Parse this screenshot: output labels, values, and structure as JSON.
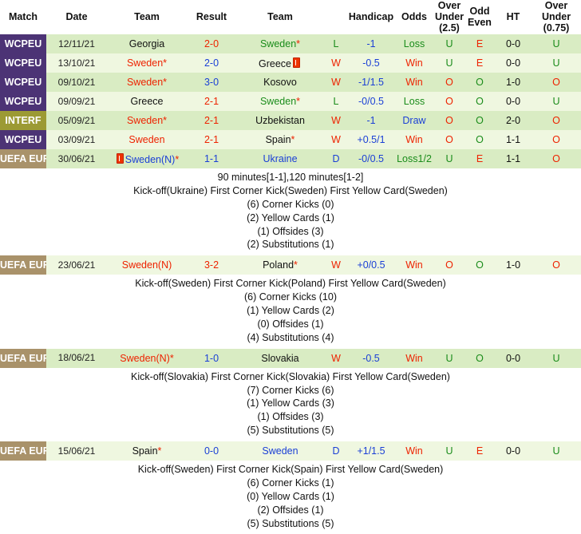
{
  "header": {
    "columns": [
      "Match",
      "Date",
      "Team",
      "Result",
      "Team",
      "Handicap",
      "Odds",
      "Over Under (2.5)",
      "Odd Even",
      "HT",
      "Over Under (0.75)"
    ],
    "col_match": "Match",
    "col_date": "Date",
    "col_team_home": "Team",
    "col_result": "Result",
    "col_team_away": "Team",
    "col_handicap": "Handicap",
    "col_odds": "Odds",
    "col_ou25_l1": "Over",
    "col_ou25_l2": "Under",
    "col_ou25_l3": "(2.5)",
    "col_oddeven_l1": "Odd",
    "col_oddeven_l2": "Even",
    "col_ht": "HT",
    "col_ou075_l1": "Over",
    "col_ou075_l2": "Under",
    "col_ou075_l3": "(0.75)"
  },
  "colors": {
    "league_wcpeu": "#4c3375",
    "league_interf": "#9c9a34",
    "league_euro": "#a9926a",
    "row_dark": "#d9ecc3",
    "row_light": "#eff7e0",
    "win_red": "#ee2200",
    "loss_green": "#1a8c1a",
    "draw_blue": "#1a3fd6",
    "red_card": "#ee3300"
  },
  "rows": [
    {
      "league": "WCPEU",
      "league_type": "wcpeu",
      "date": "12/11/21",
      "home": "Georgia",
      "home_color": "black",
      "home_star": false,
      "home_card": false,
      "result": "2-0",
      "result_color": "red",
      "away": "Sweden",
      "away_color": "green",
      "away_star": true,
      "away_card": false,
      "handicap_res": "L",
      "handicap_res_color": "green",
      "handicap": "-1",
      "handicap_color": "blue",
      "odds": "Loss",
      "odds_color": "green",
      "ou25": "U",
      "ou25_color": "green",
      "oddeven": "E",
      "oddeven_color": "red",
      "ht": "0-0",
      "ou075": "U",
      "ou075_color": "green",
      "detail": null
    },
    {
      "league": "WCPEU",
      "league_type": "wcpeu",
      "date": "13/10/21",
      "home": "Sweden",
      "home_color": "red",
      "home_star": true,
      "home_card": false,
      "result": "2-0",
      "result_color": "blue",
      "away": "Greece",
      "away_color": "black",
      "away_star": false,
      "away_card": true,
      "handicap_res": "W",
      "handicap_res_color": "red",
      "handicap": "-0.5",
      "handicap_color": "blue",
      "odds": "Win",
      "odds_color": "red",
      "ou25": "U",
      "ou25_color": "green",
      "oddeven": "E",
      "oddeven_color": "red",
      "ht": "0-0",
      "ou075": "U",
      "ou075_color": "green",
      "detail": null
    },
    {
      "league": "WCPEU",
      "league_type": "wcpeu",
      "date": "09/10/21",
      "home": "Sweden",
      "home_color": "red",
      "home_star": true,
      "home_card": false,
      "result": "3-0",
      "result_color": "blue",
      "away": "Kosovo",
      "away_color": "black",
      "away_star": false,
      "away_card": false,
      "handicap_res": "W",
      "handicap_res_color": "red",
      "handicap": "-1/1.5",
      "handicap_color": "blue",
      "odds": "Win",
      "odds_color": "red",
      "ou25": "O",
      "ou25_color": "red",
      "oddeven": "O",
      "oddeven_color": "green",
      "ht": "1-0",
      "ou075": "O",
      "ou075_color": "red",
      "detail": null
    },
    {
      "league": "WCPEU",
      "league_type": "wcpeu",
      "date": "09/09/21",
      "home": "Greece",
      "home_color": "black",
      "home_star": false,
      "home_card": false,
      "result": "2-1",
      "result_color": "red",
      "away": "Sweden",
      "away_color": "green",
      "away_star": true,
      "away_card": false,
      "handicap_res": "L",
      "handicap_res_color": "green",
      "handicap": "-0/0.5",
      "handicap_color": "blue",
      "odds": "Loss",
      "odds_color": "green",
      "ou25": "O",
      "ou25_color": "red",
      "oddeven": "O",
      "oddeven_color": "green",
      "ht": "0-0",
      "ou075": "U",
      "ou075_color": "green",
      "detail": null
    },
    {
      "league": "INTERF",
      "league_type": "interf",
      "date": "05/09/21",
      "home": "Sweden",
      "home_color": "red",
      "home_star": true,
      "home_card": false,
      "result": "2-1",
      "result_color": "red",
      "away": "Uzbekistan",
      "away_color": "black",
      "away_star": false,
      "away_card": false,
      "handicap_res": "W",
      "handicap_res_color": "red",
      "handicap": "-1",
      "handicap_color": "blue",
      "odds": "Draw",
      "odds_color": "blue",
      "ou25": "O",
      "ou25_color": "red",
      "oddeven": "O",
      "oddeven_color": "green",
      "ht": "2-0",
      "ou075": "O",
      "ou075_color": "red",
      "detail": null
    },
    {
      "league": "WCPEU",
      "league_type": "wcpeu",
      "date": "03/09/21",
      "home": "Sweden",
      "home_color": "red",
      "home_star": false,
      "home_card": false,
      "result": "2-1",
      "result_color": "red",
      "away": "Spain",
      "away_color": "black",
      "away_star": true,
      "away_card": false,
      "handicap_res": "W",
      "handicap_res_color": "red",
      "handicap": "+0.5/1",
      "handicap_color": "blue",
      "odds": "Win",
      "odds_color": "red",
      "ou25": "O",
      "ou25_color": "red",
      "oddeven": "O",
      "oddeven_color": "green",
      "ht": "1-1",
      "ou075": "O",
      "ou075_color": "red",
      "detail": null
    },
    {
      "league": "UEFA EURO",
      "league_type": "euro",
      "date": "30/06/21",
      "home": "Sweden(N)",
      "home_color": "blue",
      "home_star": true,
      "home_card": true,
      "result": "1-1",
      "result_color": "blue",
      "away": "Ukraine",
      "away_color": "blue",
      "away_star": false,
      "away_card": false,
      "handicap_res": "D",
      "handicap_res_color": "blue",
      "handicap": "-0/0.5",
      "handicap_color": "blue",
      "odds": "Loss1/2",
      "odds_color": "green",
      "ou25": "U",
      "ou25_color": "green",
      "oddeven": "E",
      "oddeven_color": "red",
      "ht": "1-1",
      "ou075": "O",
      "ou075_color": "red",
      "detail": {
        "extra_time": "90 minutes[1-1],120 minutes[1-2]",
        "events": "Kick-off(Ukraine)  First Corner Kick(Sweden)  First Yellow Card(Sweden)",
        "corner_kicks": "(6) Corner Kicks (0)",
        "yellow_cards": "(2) Yellow Cards (1)",
        "offsides": "(1) Offsides (3)",
        "substitutions": "(2) Substitutions (1)"
      }
    },
    {
      "league": "UEFA EURO",
      "league_type": "euro",
      "date": "23/06/21",
      "home": "Sweden(N)",
      "home_color": "red",
      "home_star": false,
      "home_card": false,
      "result": "3-2",
      "result_color": "red",
      "away": "Poland",
      "away_color": "black",
      "away_star": true,
      "away_card": false,
      "handicap_res": "W",
      "handicap_res_color": "red",
      "handicap": "+0/0.5",
      "handicap_color": "blue",
      "odds": "Win",
      "odds_color": "red",
      "ou25": "O",
      "ou25_color": "red",
      "oddeven": "O",
      "oddeven_color": "green",
      "ht": "1-0",
      "ou075": "O",
      "ou075_color": "red",
      "detail": {
        "extra_time": null,
        "events": "Kick-off(Sweden)  First Corner Kick(Poland)  First Yellow Card(Sweden)",
        "corner_kicks": "(6) Corner Kicks (10)",
        "yellow_cards": "(1) Yellow Cards (2)",
        "offsides": "(0) Offsides (1)",
        "substitutions": "(4) Substitutions (4)"
      }
    },
    {
      "league": "UEFA EURO",
      "league_type": "euro",
      "date": "18/06/21",
      "home": "Sweden(N)",
      "home_color": "red",
      "home_star": true,
      "home_card": false,
      "result": "1-0",
      "result_color": "blue",
      "away": "Slovakia",
      "away_color": "black",
      "away_star": false,
      "away_card": false,
      "handicap_res": "W",
      "handicap_res_color": "red",
      "handicap": "-0.5",
      "handicap_color": "blue",
      "odds": "Win",
      "odds_color": "red",
      "ou25": "U",
      "ou25_color": "green",
      "oddeven": "O",
      "oddeven_color": "green",
      "ht": "0-0",
      "ou075": "U",
      "ou075_color": "green",
      "detail": {
        "extra_time": null,
        "events": "Kick-off(Slovakia)  First Corner Kick(Slovakia)  First Yellow Card(Sweden)",
        "corner_kicks": "(7) Corner Kicks (6)",
        "yellow_cards": "(1) Yellow Cards (3)",
        "offsides": "(1) Offsides (3)",
        "substitutions": "(5) Substitutions (5)"
      }
    },
    {
      "league": "UEFA EURO",
      "league_type": "euro",
      "date": "15/06/21",
      "home": "Spain",
      "home_color": "black",
      "home_star": true,
      "home_card": false,
      "result": "0-0",
      "result_color": "blue",
      "away": "Sweden",
      "away_color": "blue",
      "away_star": false,
      "away_card": false,
      "handicap_res": "D",
      "handicap_res_color": "blue",
      "handicap": "+1/1.5",
      "handicap_color": "blue",
      "odds": "Win",
      "odds_color": "red",
      "ou25": "U",
      "ou25_color": "green",
      "oddeven": "E",
      "oddeven_color": "red",
      "ht": "0-0",
      "ou075": "U",
      "ou075_color": "green",
      "detail": {
        "extra_time": null,
        "events": "Kick-off(Sweden)  First Corner Kick(Spain)  First Yellow Card(Sweden)",
        "corner_kicks": "(6) Corner Kicks (1)",
        "yellow_cards": "(0) Yellow Cards (1)",
        "offsides": "(2) Offsides (1)",
        "substitutions": "(5) Substitutions (5)"
      }
    }
  ]
}
